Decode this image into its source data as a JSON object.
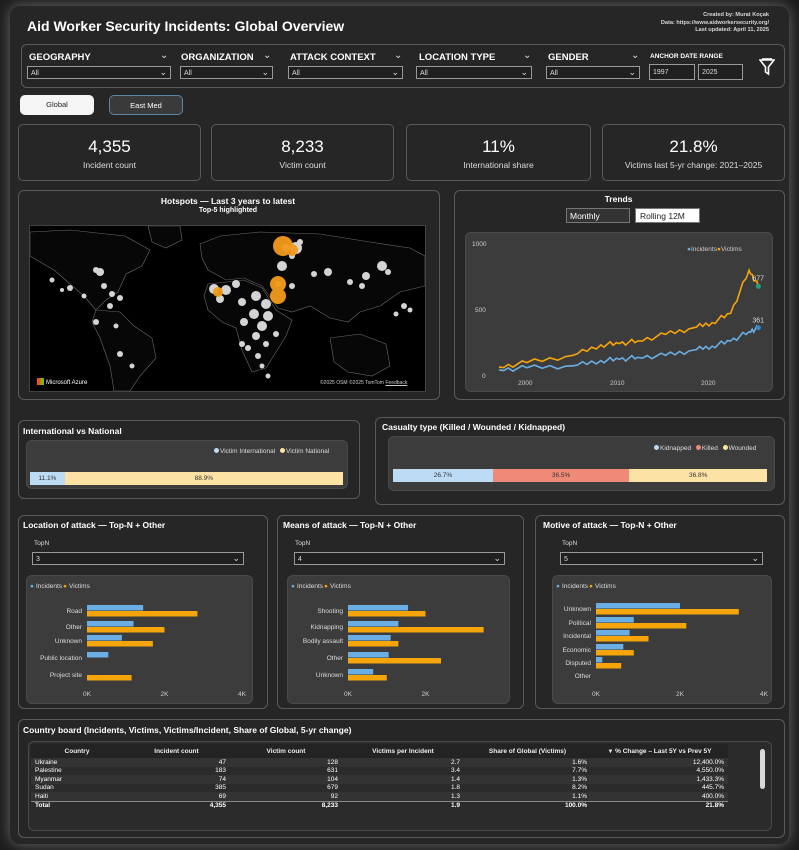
{
  "header": {
    "title": "Aid Worker Security Incidents: Global Overview",
    "created_by": "Created by: Murat Koçak",
    "data_source": "Data: https://www.aidworkersecurity.org/",
    "last_updated": "Last updated: April 11, 2025"
  },
  "filters": {
    "geography": {
      "label": "GEOGRAPHY",
      "value": "All"
    },
    "organization": {
      "label": "ORGANIZATION",
      "value": "All"
    },
    "attack_context": {
      "label": "ATTACK CONTEXT",
      "value": "All"
    },
    "location_type": {
      "label": "LOCATION TYPE",
      "value": "All"
    },
    "gender": {
      "label": "GENDER",
      "value": "All"
    },
    "anchor": {
      "label": "ANCHOR DATE RANGE",
      "from": "1997",
      "to": "2025"
    }
  },
  "views": {
    "global": "Global",
    "east_med": "East Med"
  },
  "kpis": [
    {
      "value": "4,355",
      "label": "Incident count"
    },
    {
      "value": "8,233",
      "label": "Victim count"
    },
    {
      "value": "11%",
      "label": "International share"
    },
    {
      "value": "21.8%",
      "label": "Victims last 5-yr change: 2021–2025"
    }
  ],
  "map": {
    "title": "Hotspots — Last 3 years to latest",
    "subtitle": "Top-5 highlighted",
    "brand": "Microsoft Azure",
    "copyright": "©2025 OSM  ©2025 TomTom",
    "feedback": "Feedback"
  },
  "trends": {
    "title": "Trends",
    "tab_monthly": "Monthly",
    "tab_rolling": "Rolling 12M",
    "end_label_victims": "677",
    "end_label_incidents": "361"
  },
  "intl_vs_national": {
    "title": "International vs National",
    "legend": [
      "Victim International",
      "Victim National"
    ],
    "values": [
      11.1,
      88.9
    ],
    "labels": [
      "11.1%",
      "88.9%"
    ],
    "colors": [
      "#bcdcf5",
      "#fde2a6"
    ]
  },
  "casualty": {
    "title": "Casualty type (Killed / Wounded / Kidnapped)",
    "legend": [
      "Kidnapped",
      "Killed",
      "Wounded"
    ],
    "values": [
      26.7,
      36.5,
      36.8
    ],
    "labels": [
      "26.7%",
      "36.5%",
      "36.8%"
    ],
    "colors": [
      "#bcdcf5",
      "#f08a78",
      "#fde2a6"
    ]
  },
  "colors": {
    "incidents": "#6aaee3",
    "victims": "#f5a50a",
    "frame_bg": "#262626"
  },
  "chart_data": [
    {
      "type": "line",
      "title": "Trends",
      "series": [
        {
          "name": "Incidents",
          "x": [
            1997,
            2000,
            2005,
            2008,
            2010,
            2012,
            2015,
            2018,
            2020,
            2022,
            2024,
            2025
          ],
          "values": [
            40,
            55,
            70,
            110,
            120,
            135,
            150,
            190,
            220,
            260,
            330,
            361
          ]
        },
        {
          "name": "Victims",
          "x": [
            1997,
            2000,
            2005,
            2008,
            2010,
            2012,
            2015,
            2018,
            2020,
            2022,
            2024,
            2025
          ],
          "values": [
            60,
            95,
            150,
            230,
            240,
            260,
            310,
            360,
            400,
            470,
            800,
            677
          ]
        }
      ],
      "xticks": [
        "2000",
        "2010",
        "2020"
      ],
      "yticks": [
        "0",
        "500",
        "1000"
      ],
      "ylim": [
        0,
        1000
      ]
    },
    {
      "type": "bar",
      "title": "Location of attack — Top-N + Other",
      "topn_label": "TopN",
      "topn_value": "3",
      "categories": [
        "Road",
        "Other",
        "Unknown",
        "Public location",
        "Project site"
      ],
      "series": [
        {
          "name": "Incidents",
          "values": [
            1450,
            1200,
            900,
            550,
            0
          ]
        },
        {
          "name": "Victims",
          "values": [
            2850,
            2000,
            1700,
            0,
            1150
          ]
        }
      ],
      "xticks": [
        "0K",
        "2K",
        "4K"
      ],
      "xlim": [
        0,
        4000
      ]
    },
    {
      "type": "bar",
      "title": "Means of attack — Top-N + Other",
      "topn_label": "TopN",
      "topn_value": "4",
      "categories": [
        "Shooting",
        "Kidnapping",
        "Bodily assault",
        "Other",
        "Unknown"
      ],
      "series": [
        {
          "name": "Incidents",
          "values": [
            1550,
            1300,
            1100,
            1050,
            650
          ]
        },
        {
          "name": "Victims",
          "values": [
            2000,
            3500,
            1300,
            2400,
            1000
          ]
        }
      ],
      "xticks": [
        "0K",
        "2K"
      ],
      "xlim": [
        0,
        4000
      ]
    },
    {
      "type": "bar",
      "title": "Motive of attack — Top-N + Other",
      "topn_label": "TopN",
      "topn_value": "5",
      "categories": [
        "Unknown",
        "Political",
        "Incidental",
        "Economic",
        "Disputed",
        "Other"
      ],
      "series": [
        {
          "name": "Incidents",
          "values": [
            2000,
            900,
            800,
            650,
            150,
            0
          ]
        },
        {
          "name": "Victims",
          "values": [
            3400,
            2150,
            1250,
            900,
            600,
            0
          ]
        }
      ],
      "xticks": [
        "0K",
        "2K",
        "4K"
      ],
      "xlim": [
        0,
        4000
      ]
    }
  ],
  "country_board": {
    "title": "Country board (Incidents, Victims, Victims/Incident, Share of Global, 5-yr change)",
    "columns": [
      "Country",
      "Incident count",
      "Victim count",
      "Victims per Incident",
      "Share of Global (Victims)",
      "% Change – Last 5Y vs Prev 5Y"
    ],
    "rows": [
      [
        "Ukraine",
        "47",
        "128",
        "2.7",
        "1.6%",
        "12,400.0%"
      ],
      [
        "Palestine",
        "183",
        "631",
        "3.4",
        "7.7%",
        "4,550.0%"
      ],
      [
        "Myanmar",
        "74",
        "104",
        "1.4",
        "1.3%",
        "1,433.3%"
      ],
      [
        "Sudan",
        "385",
        "679",
        "1.8",
        "8.2%",
        "445.7%"
      ],
      [
        "Haiti",
        "69",
        "92",
        "1.3",
        "1.1%",
        "400.0%"
      ]
    ],
    "total": [
      "Total",
      "4,355",
      "8,233",
      "1.9",
      "100.0%",
      "21.8%"
    ]
  }
}
